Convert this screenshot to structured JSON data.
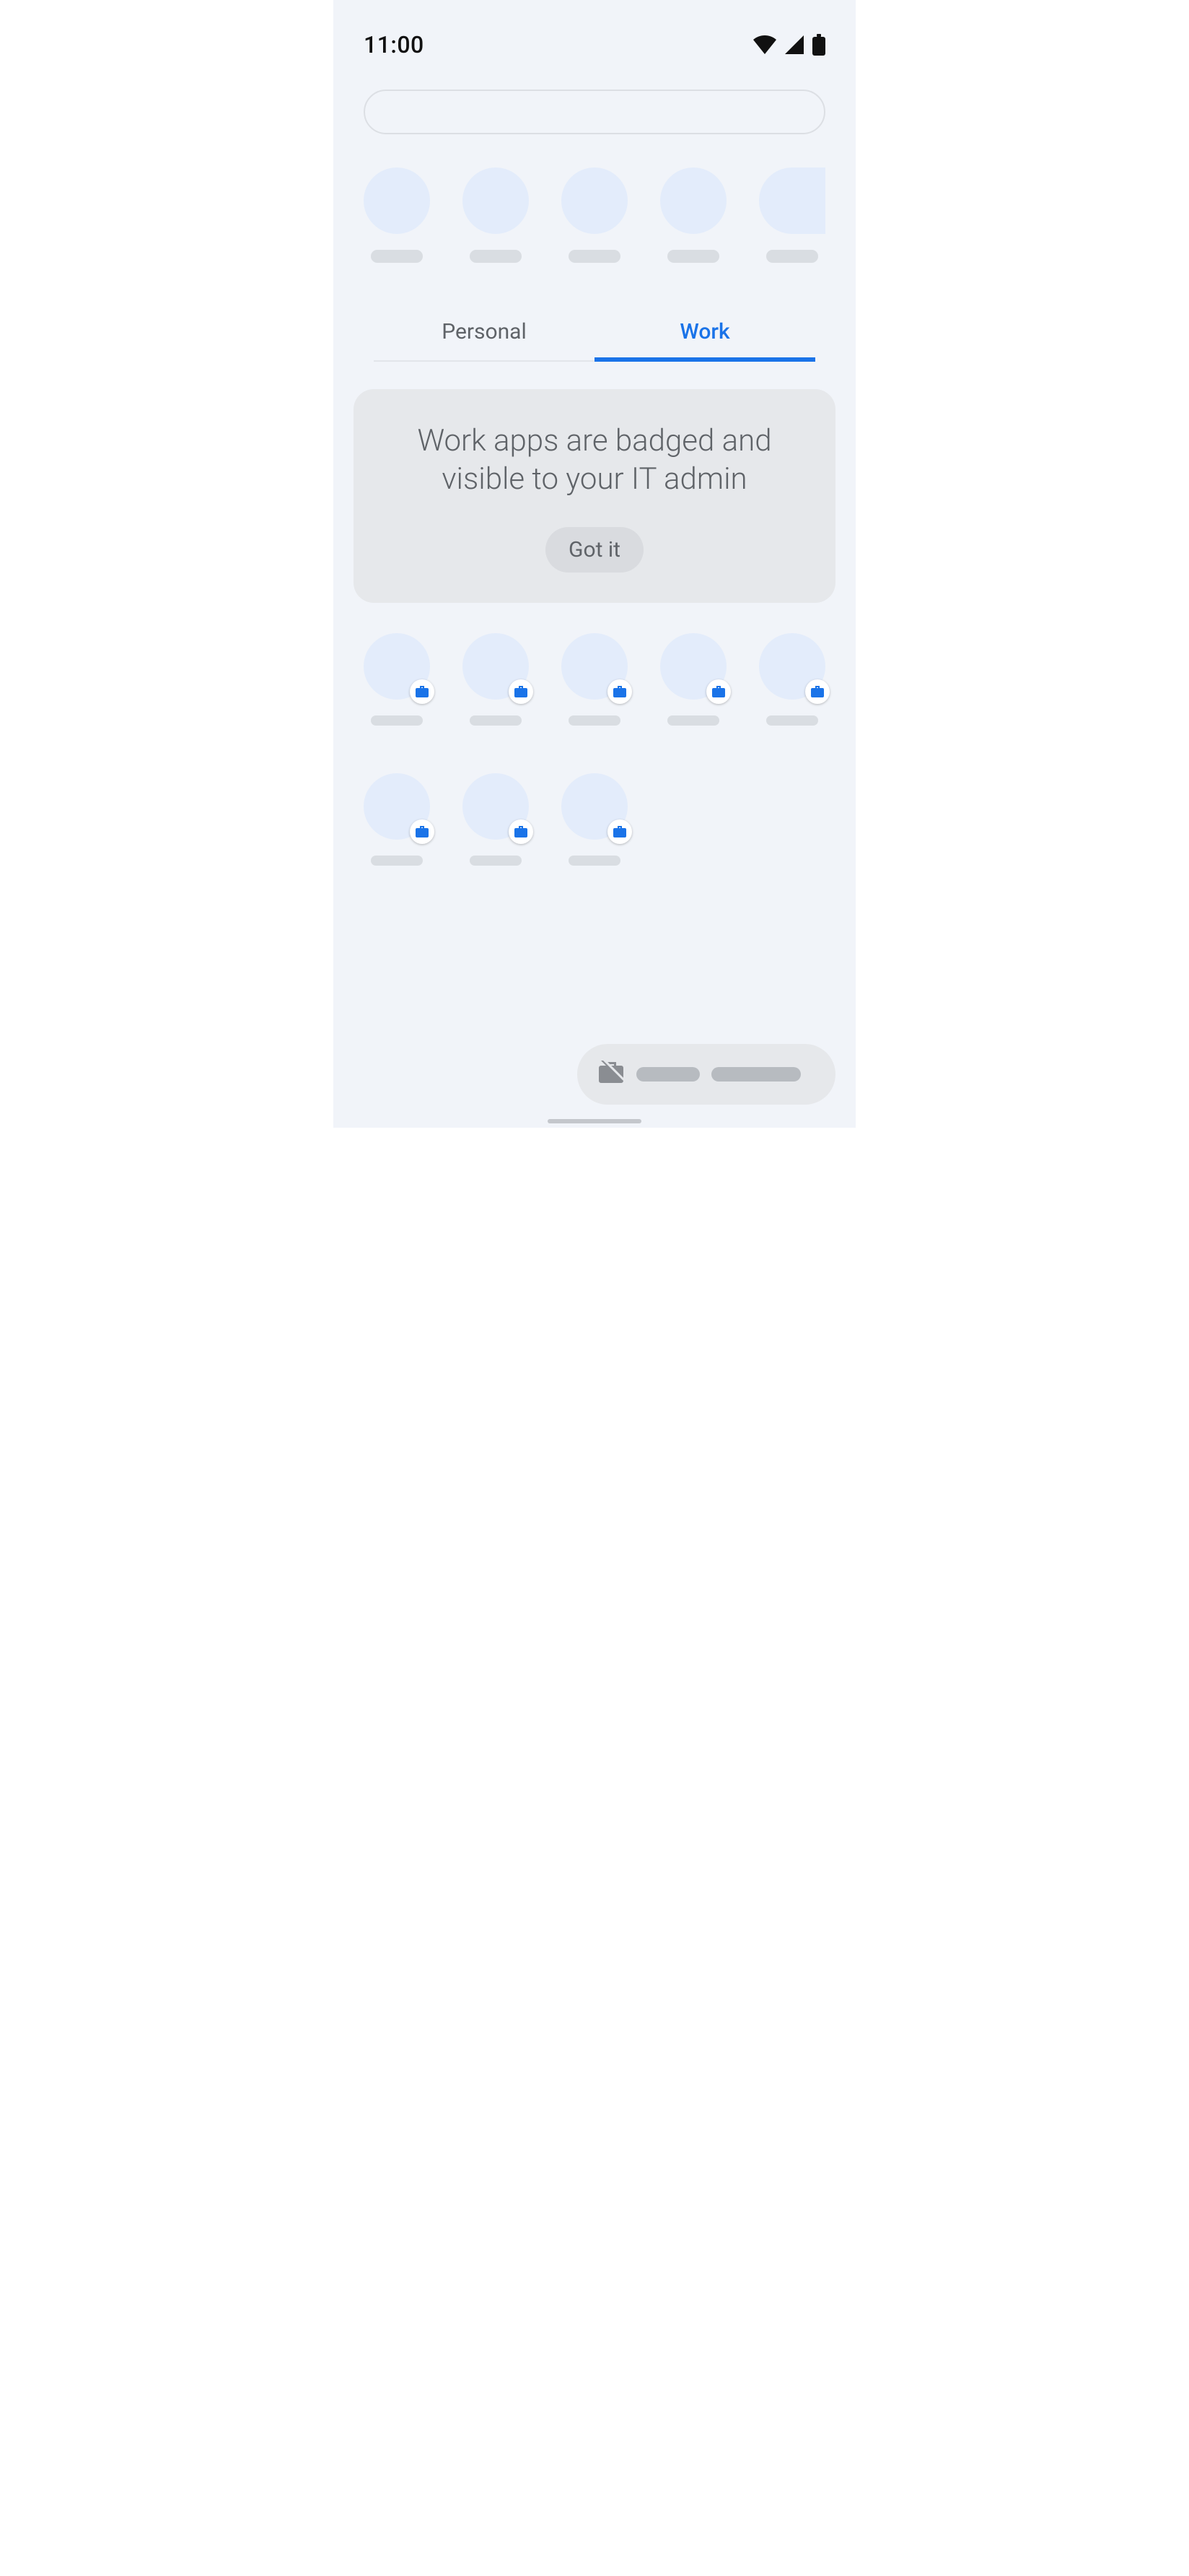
{
  "status_bar": {
    "time": "11:00",
    "icons": [
      "wifi-icon",
      "signal-icon",
      "battery-icon"
    ]
  },
  "search": {
    "placeholder": ""
  },
  "suggested_apps": {
    "count": 5
  },
  "tabs": {
    "personal": {
      "label": "Personal",
      "active": false
    },
    "work": {
      "label": "Work",
      "active": true
    }
  },
  "notice": {
    "message": "Work apps are badged and visible to your IT admin",
    "button_label": "Got it"
  },
  "work_apps": {
    "row1_count": 5,
    "row2_count": 3,
    "badge_icon": "briefcase-icon",
    "badge_color": "#1a73e8"
  },
  "bottom_pill": {
    "icon": "briefcase-off-icon"
  }
}
